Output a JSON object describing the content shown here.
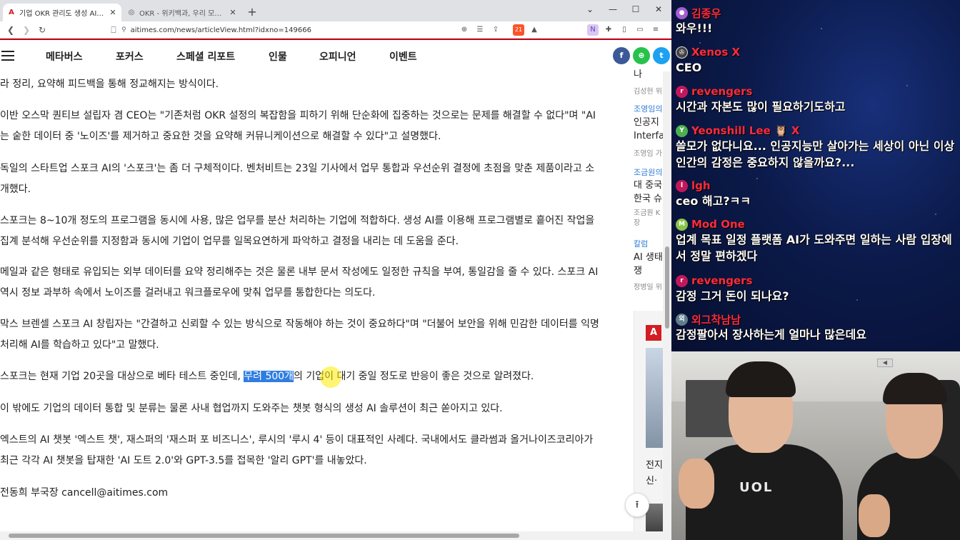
{
  "browser": {
    "tabs": [
      {
        "title": "기업 OKR 관리도 생성 AI가 해준다",
        "active": true
      },
      {
        "title": "OKR - 위키백과, 우리 모두의 백과사전",
        "active": false
      }
    ],
    "url": "aitimes.com/news/articleView.html?idxno=149666",
    "extension_badge": "21"
  },
  "site": {
    "nav": [
      "메타버스",
      "포커스",
      "스페셜 리포트",
      "인물",
      "오피니언",
      "이벤트"
    ],
    "share_buttons": [
      {
        "icon": "facebook-icon",
        "glyph": "f",
        "color": "#3b5998"
      },
      {
        "icon": "share-icon",
        "glyph": "⊕",
        "color": "#27c24c"
      },
      {
        "icon": "twitter-icon",
        "glyph": "t",
        "color": "#1da1f2"
      }
    ]
  },
  "article": {
    "paragraphs": [
      "라 정리, 요약해 피드백을 통해 정교해지는 방식이다.",
      "이반 오스막 퀀티브 설립자 겸 CEO는 \"기존처럼 OKR 설정의 복잡함을 피하기 위해 단순화에 집중하는 것으로는 문제를 해결할 수 없다\"며 \"AI는 숱한 데이터 중 '노이즈'를 제거하고 중요한 것을 요약해 커뮤니케이션으로 해결할 수 있다\"고 설명했다.",
      "독일의 스타트업 스포크 AI의 '스포크'는 좀 더 구체적이다. 벤처비트는 23일 기사에서 업무 통합과 우선순위 결정에 초점을 맞춘 제품이라고 소개했다.",
      "스포크는 8~10개 정도의 프로그램을 동시에 사용, 많은 업무를 분산 처리하는 기업에 적합하다. 생성 AI를 이용해 프로그램별로 흩어진 작업을 집계 분석해 우선순위를 지정함과 동시에 기업이 업무를 일목요연하게 파악하고 결정을 내리는 데 도움을 준다.",
      "메일과 같은 형태로 유입되는 외부 데이터를 요약 정리해주는 것은 물론 내부 문서 작성에도 일정한 규칙을 부여, 통일감을 줄 수 있다. 스포크 AI 역시 정보 과부하 속에서 노이즈를 걸러내고 워크플로우에 맞춰 업무를 통합한다는 의도다.",
      "막스 브렌셀 스포크 AI 창립자는 \"간결하고 신뢰할 수 있는 방식으로 작동해야 하는 것이 중요하다\"며 \"더불어 보안을 위해 민감한 데이터를 익명 처리해 AI를 학습하고 있다\"고 말했다."
    ],
    "highlight_para": {
      "before": "스포크는 현재 기업 20곳을 대상으로 베타 테스트 중인데, ",
      "highlight": "무려 500개",
      "after": "의 기업이 대기 중일 정도로 반응이 좋은 것으로 알려졌다."
    },
    "paragraphs_after": [
      "이 밖에도 기업의 데이터 통합 및 분류는 물론 사내 협업까지 도와주는 챗봇 형식의 생성 AI 솔루션이 최근 쏟아지고 있다.",
      "엑스트의 AI 챗봇 '엑스트 챗', 재스퍼의 '재스퍼 포 비즈니스', 루시의 '루시 4' 등이 대표적인 사례다. 국내에서도 클라썸과 올거나이즈코리아가 최근 각각 AI 챗봇을 탑재한 'AI 도트 2.0'와 GPT-3.5를 접목한 '알리 GPT'를 내놓았다."
    ],
    "byline": "전동희 부국장 cancell@aitimes.com"
  },
  "sidebar": {
    "items": [
      {
        "category": "",
        "title": "나",
        "author": "김성현 위"
      },
      {
        "category": "조영임의",
        "title": "인공지\nInterfa",
        "author": "조영임 가"
      },
      {
        "category": "조금원의",
        "title": "대 중국\n한국 슈",
        "author": "조금원 K\n장"
      },
      {
        "category": "칼럼",
        "title": "AI 생태\n쟁",
        "author": "정병일 위"
      }
    ],
    "ad_text": "전지\n신·"
  },
  "chat": {
    "messages": [
      {
        "nick": "김종우",
        "avatar_color": "#a15fd0",
        "text": "와우!!!"
      },
      {
        "nick": "Xenos X",
        "avatar_color": "#444",
        "text": "CEO"
      },
      {
        "nick": "revengers",
        "avatar_color": "#c2185b",
        "text": "시간과 자본도 많이 필요하기도하고"
      },
      {
        "nick": "Yeonshill Lee 🦉 X",
        "avatar_color": "#4caf50",
        "text": "쓸모가 없다니요... 인공지능만 살아가는 세상이 아닌 이상 인간의 감정은 중요하지 않을까요?..."
      },
      {
        "nick": "lgh",
        "avatar_color": "#c2185b",
        "text": "ceo 해고?ㅋㅋ"
      },
      {
        "nick": "Mod One",
        "avatar_color": "#8bc34a",
        "text": "업계 목표 일정 플랫폼 AI가 도와주면 일하는 사람 입장에서 정말 편하겠다"
      },
      {
        "nick": "revengers",
        "avatar_color": "#c2185b",
        "text": "감정 그거 돈이 되나요?"
      },
      {
        "nick": "외그작남남",
        "avatar_color": "#607d8b",
        "text": "감정팔아서 장사하는게 얼마나 많은데요"
      }
    ]
  },
  "cam": {
    "shirt_text": "UOL"
  }
}
